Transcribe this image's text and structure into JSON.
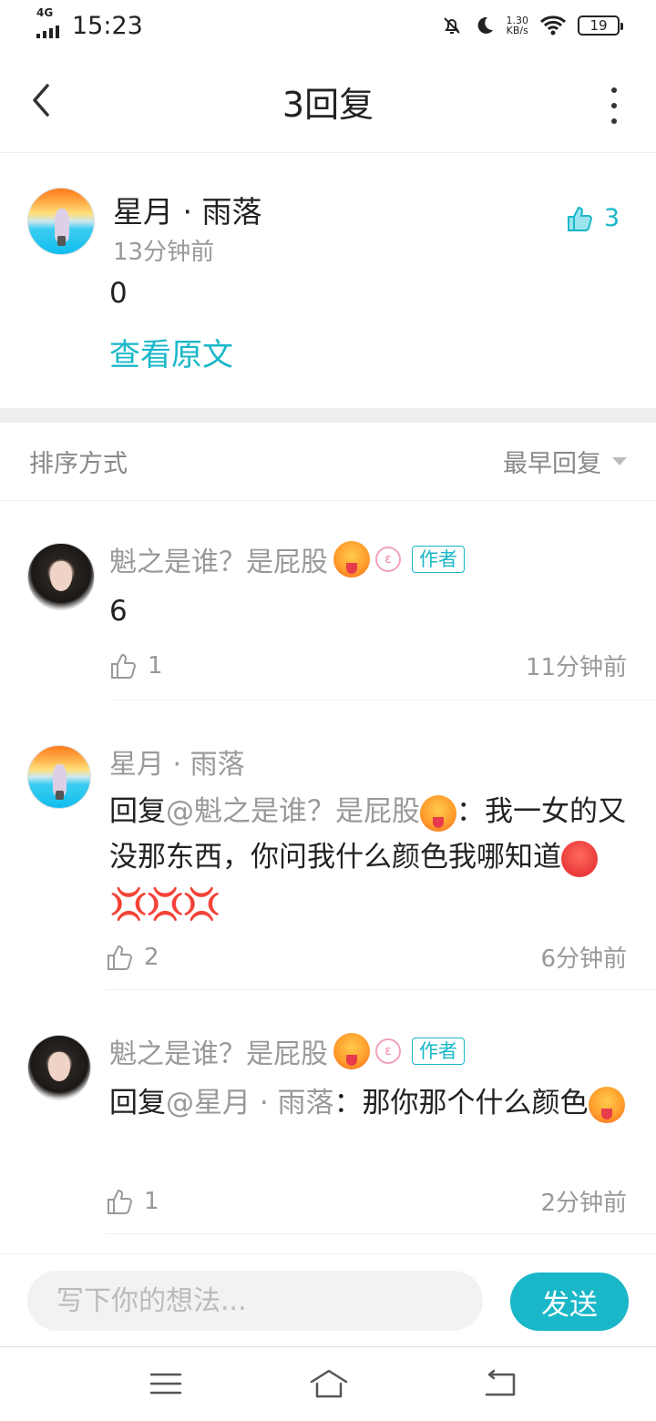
{
  "status_bar": {
    "network": "4G",
    "time": "15:23",
    "speed_value": "1.30",
    "speed_unit": "KB/s",
    "battery": "19"
  },
  "nav": {
    "title": "3回复"
  },
  "main_post": {
    "author": "星月 · 雨落",
    "time": "13分钟前",
    "content": "0",
    "view_original": "查看原文",
    "likes": "3"
  },
  "sort": {
    "label": "排序方式",
    "value": "最早回复"
  },
  "replies": [
    {
      "name": "魁之是谁？是屁股",
      "badge_ring": "ε",
      "badge": "作者",
      "content": "6",
      "likes": "1",
      "time": "11分钟前"
    },
    {
      "name": "星月 · 雨落",
      "reply_prefix": "回复",
      "at_user": "@魁之是谁？是屁股",
      "content_after": "：我一女的又没那东西，你问我什么颜色我哪知道",
      "anger_marks": [
        "💢",
        "💢",
        "💢"
      ],
      "likes": "2",
      "time": "6分钟前"
    },
    {
      "name": "魁之是谁？是屁股",
      "badge_ring": "ε",
      "badge": "作者",
      "reply_prefix": "回复",
      "at_user": "@星月 · 雨落",
      "content_after": "：那你那个什么颜色",
      "likes": "1",
      "time": "2分钟前"
    }
  ],
  "compose": {
    "placeholder": "写下你的想法...",
    "send_label": "发送"
  },
  "colors": {
    "accent": "#19b7c8",
    "muted_text": "#999999",
    "divider": "#eeeeee"
  }
}
